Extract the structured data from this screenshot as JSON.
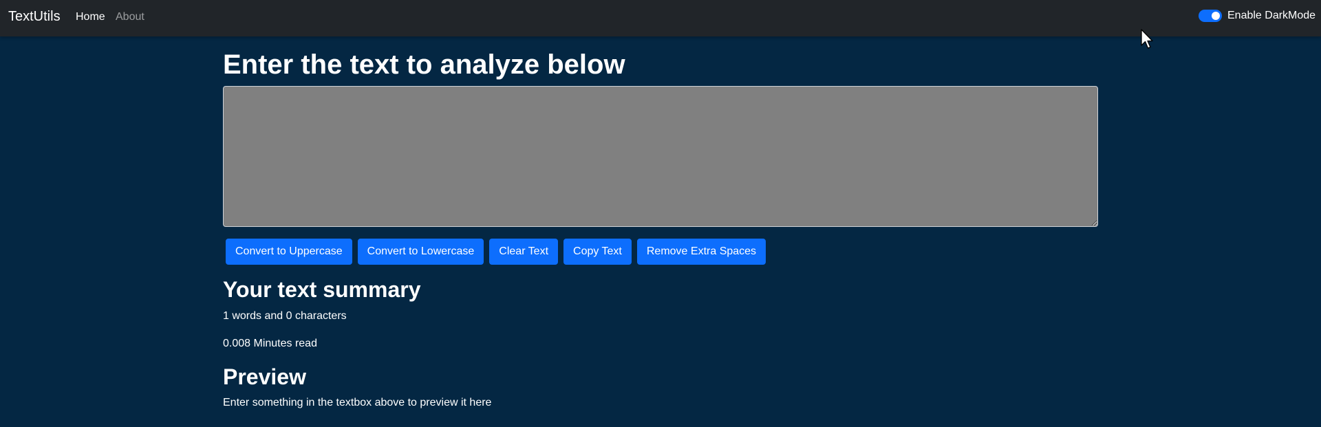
{
  "navbar": {
    "brand": "TextUtils",
    "links": [
      "Home",
      "About"
    ],
    "darkmode_label": "Enable DarkMode",
    "darkmode_enabled": true
  },
  "main": {
    "title": "Enter the text to analyze below",
    "textbox_value": "",
    "buttons": [
      "Convert to Uppercase",
      "Convert to Lowercase",
      "Clear Text",
      "Copy Text",
      "Remove Extra Spaces"
    ]
  },
  "summary": {
    "title": "Your text summary",
    "counts": "1 words and 0 characters",
    "read_time": "0.008 Minutes read"
  },
  "preview": {
    "title": "Preview",
    "text": "Enter something in the textbox above to preview it here"
  },
  "colors": {
    "background": "#042743",
    "navbar": "#212529",
    "button": "#0d6efd",
    "textbox": "#808080"
  }
}
